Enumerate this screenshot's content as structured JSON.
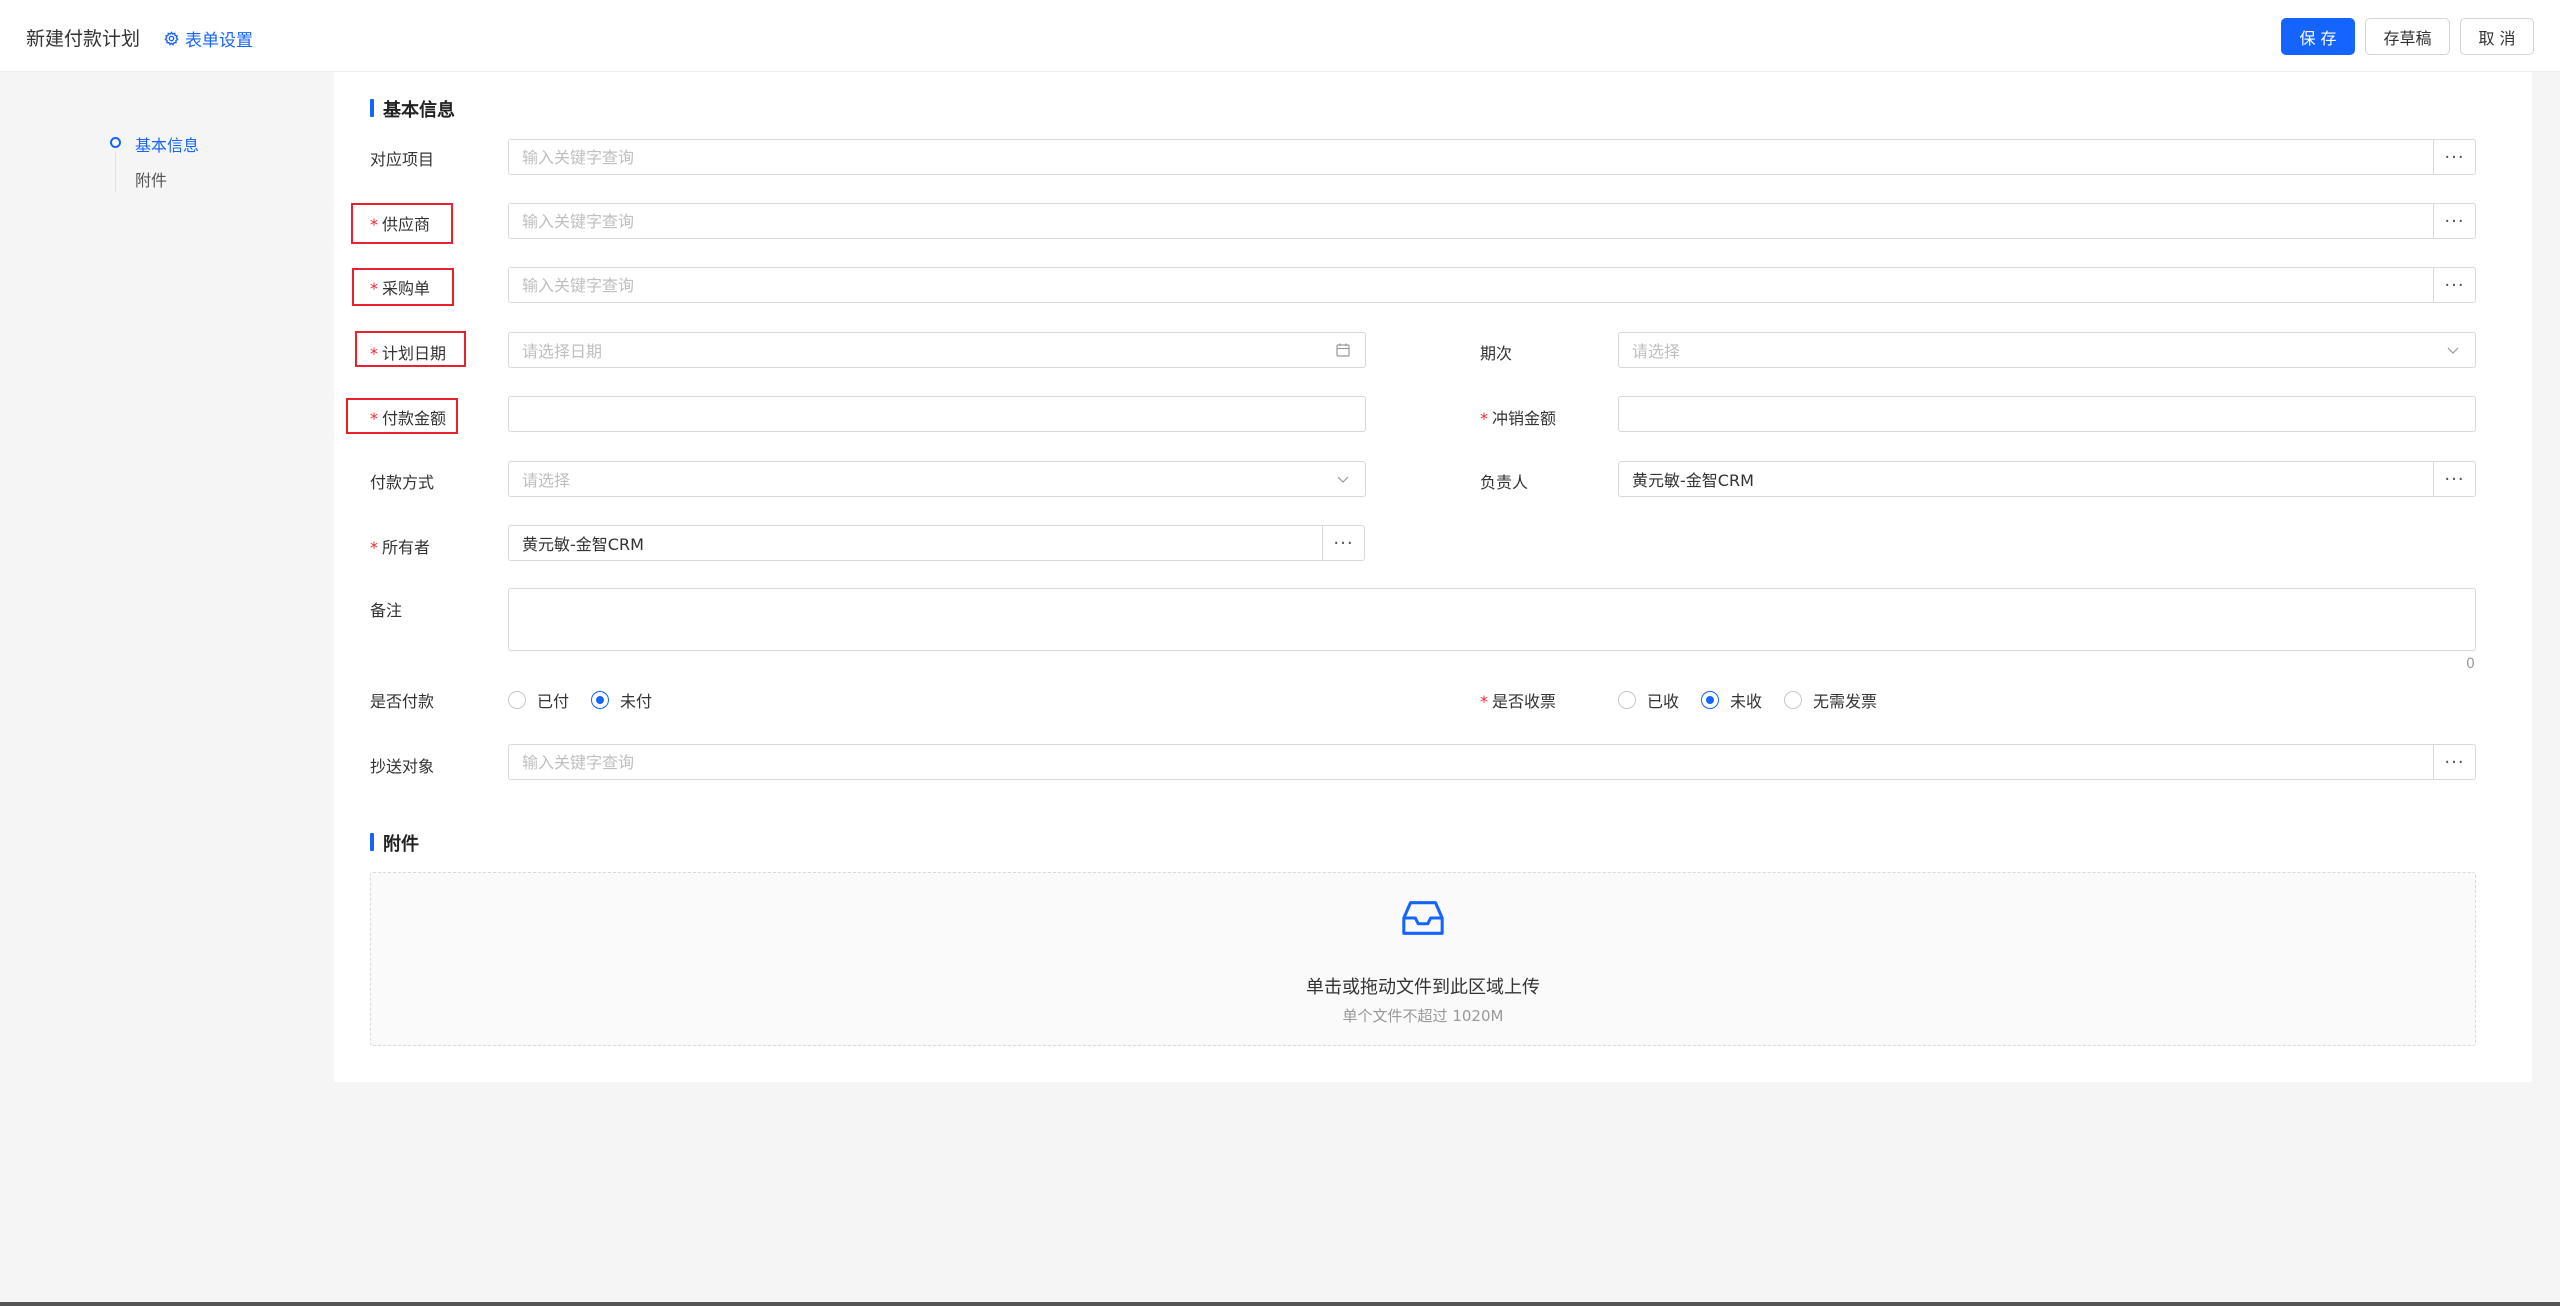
{
  "header": {
    "title": "新建付款计划",
    "settings_label": "表单设置",
    "save_label": "保 存",
    "draft_label": "存草稿",
    "cancel_label": "取 消"
  },
  "nav": {
    "items": [
      {
        "label": "基本信息",
        "active": true
      },
      {
        "label": "附件",
        "active": false
      }
    ]
  },
  "sections": {
    "basic": "基本信息",
    "attachment": "附件"
  },
  "form": {
    "project": {
      "label": "对应项目",
      "placeholder": "输入关键字查询",
      "required": false
    },
    "supplier": {
      "label": "供应商",
      "placeholder": "输入关键字查询",
      "required": true
    },
    "purchase_order": {
      "label": "采购单",
      "placeholder": "输入关键字查询",
      "required": true
    },
    "plan_date": {
      "label": "计划日期",
      "placeholder": "请选择日期",
      "required": true
    },
    "period": {
      "label": "期次",
      "placeholder": "请选择",
      "required": false
    },
    "amount": {
      "label": "付款金额",
      "value": "",
      "required": true
    },
    "writeoff_amount": {
      "label": "冲销金额",
      "value": "",
      "required": true
    },
    "payment_method": {
      "label": "付款方式",
      "placeholder": "请选择",
      "required": false
    },
    "responsible": {
      "label": "负责人",
      "value": "黄元敏-金智CRM",
      "required": false
    },
    "owner": {
      "label": "所有者",
      "value": "黄元敏-金智CRM",
      "required": true
    },
    "remark": {
      "label": "备注",
      "value": "",
      "count": "0"
    },
    "paid": {
      "label": "是否付款",
      "options": [
        "已付",
        "未付"
      ],
      "selected": "未付"
    },
    "invoice": {
      "label": "是否收票",
      "options": [
        "已收",
        "未收",
        "无需发票"
      ],
      "selected": "未收",
      "required": true
    },
    "cc": {
      "label": "抄送对象",
      "placeholder": "输入关键字查询",
      "required": false
    }
  },
  "upload": {
    "text": "单击或拖动文件到此区域上传",
    "hint": "单个文件不超过 1020M"
  },
  "colors": {
    "primary": "#1664ff",
    "required": "#f5222d",
    "highlight_box": "#e8212e"
  }
}
